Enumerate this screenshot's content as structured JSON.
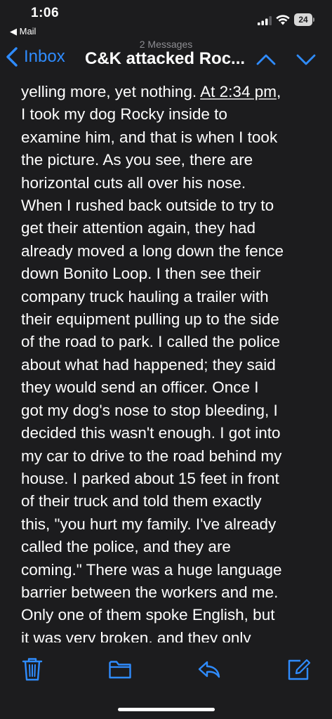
{
  "status_bar": {
    "time": "1:06",
    "back_app": "◀ Mail",
    "battery": "24"
  },
  "nav": {
    "back_label": "Inbox",
    "messages_count": "2 Messages",
    "title": "C&K attacked Roc..."
  },
  "body": {
    "lines": [
      [
        "yelling more, yet nothing. ",
        "At 2:34 pm",
        ","
      ],
      [
        "I took my dog Rocky inside to"
      ],
      [
        "examine him, and that is when I took"
      ],
      [
        "the picture. As you see, there are"
      ],
      [
        "horizontal cuts all over his nose."
      ],
      [
        "When I rushed back outside to try to"
      ],
      [
        "get their attention again, they had"
      ],
      [
        "already moved a long down the fence"
      ],
      [
        "down Bonito Loop. I then see their"
      ],
      [
        "company truck hauling a trailer with"
      ],
      [
        "their equipment pulling up to the side"
      ],
      [
        "of the road to park. I called the police"
      ],
      [
        "about what had happened; they said"
      ],
      [
        "they would send an officer. Once I"
      ],
      [
        "got my dog's nose to stop bleeding, I"
      ],
      [
        "decided this wasn't enough. I got into"
      ],
      [
        "my car to drive to the road behind my"
      ],
      [
        "house. I parked about 15 feet in front"
      ],
      [
        "of their truck and told them exactly"
      ],
      [
        "this, \"you hurt my family. I've already"
      ],
      [
        "called the police, and they are"
      ],
      [
        "coming.\" There was a huge language"
      ],
      [
        "barrier between the workers and me."
      ],
      [
        "Only one of them spoke English, but"
      ],
      [
        "it was very broken, and they only"
      ]
    ]
  },
  "toolbar": {
    "icons": [
      "trash-icon",
      "folder-icon",
      "reply-icon",
      "compose-icon"
    ]
  },
  "colors": {
    "background": "#1c1c1e",
    "accent": "#2f8cff",
    "text": "#ffffff",
    "secondary": "#8e8e93"
  }
}
